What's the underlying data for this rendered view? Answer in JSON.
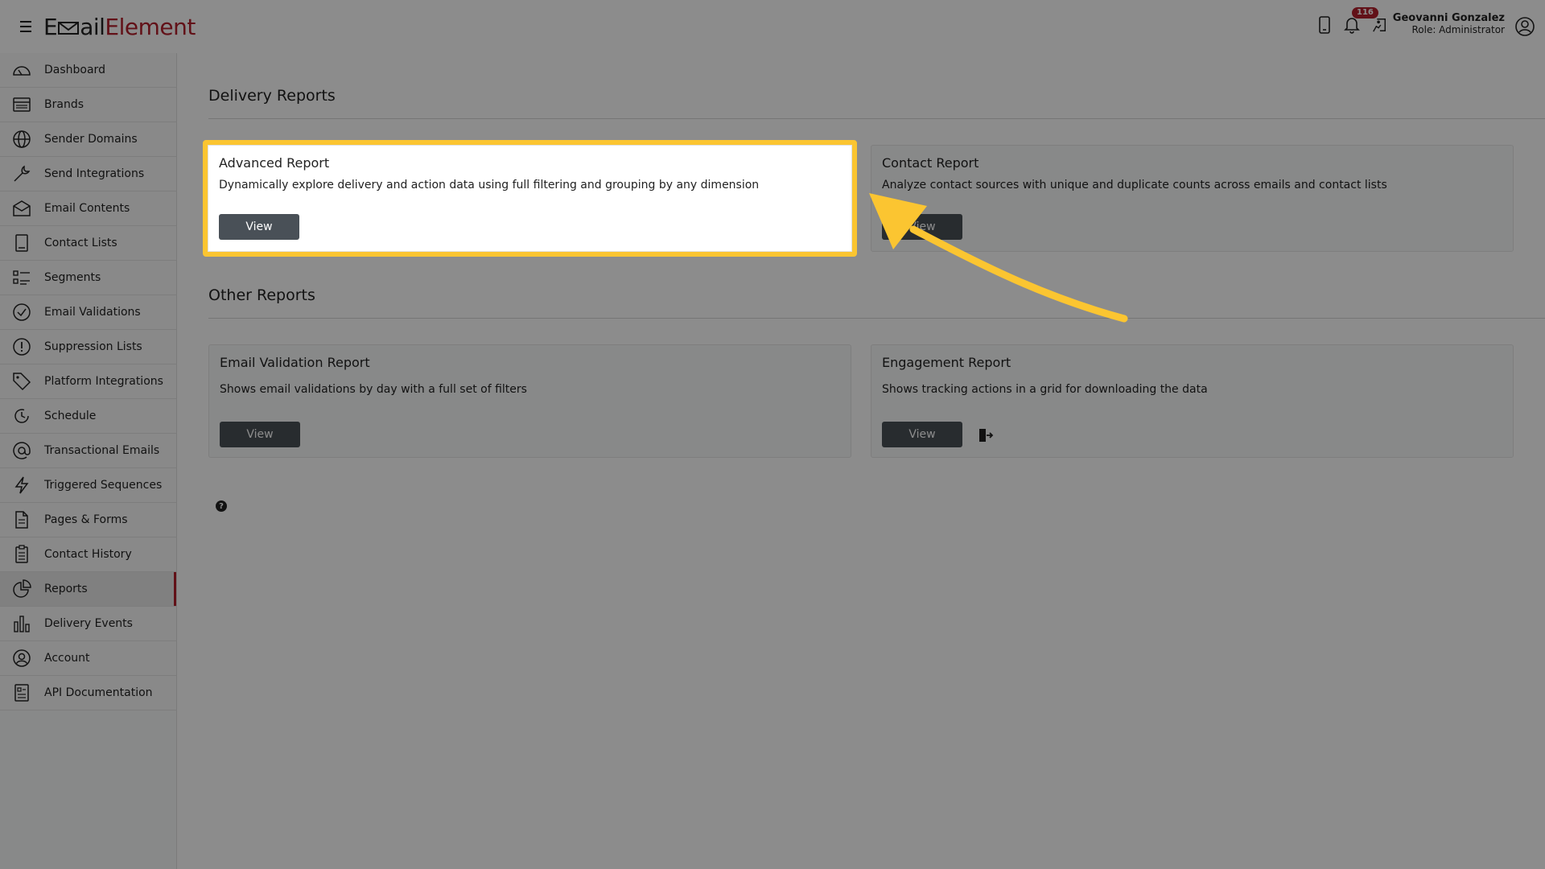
{
  "app": {
    "logo_part1": "E",
    "logo_part2": "ail",
    "logo_part3": "Element"
  },
  "header": {
    "notification_count": "116",
    "user_name": "Geovanni Gonzalez",
    "user_role": "Role: Administrator"
  },
  "sidebar": {
    "items": [
      {
        "label": "Dashboard",
        "icon": "dashboard-icon"
      },
      {
        "label": "Brands",
        "icon": "brands-icon"
      },
      {
        "label": "Sender Domains",
        "icon": "globe-icon"
      },
      {
        "label": "Send Integrations",
        "icon": "wrench-icon"
      },
      {
        "label": "Email Contents",
        "icon": "envelope-icon"
      },
      {
        "label": "Contact Lists",
        "icon": "contact-book-icon"
      },
      {
        "label": "Segments",
        "icon": "segments-icon"
      },
      {
        "label": "Email Validations",
        "icon": "check-circle-icon"
      },
      {
        "label": "Suppression Lists",
        "icon": "exclamation-circle-icon"
      },
      {
        "label": "Platform Integrations",
        "icon": "tag-icon"
      },
      {
        "label": "Schedule",
        "icon": "schedule-icon"
      },
      {
        "label": "Transactional Emails",
        "icon": "at-icon"
      },
      {
        "label": "Triggered Sequences",
        "icon": "lightning-icon"
      },
      {
        "label": "Pages & Forms",
        "icon": "document-icon"
      },
      {
        "label": "Contact History",
        "icon": "clipboard-icon"
      },
      {
        "label": "Reports",
        "icon": "pie-chart-icon",
        "active": true
      },
      {
        "label": "Delivery Events",
        "icon": "bar-chart-icon"
      },
      {
        "label": "Account",
        "icon": "user-circle-icon"
      },
      {
        "label": "API Documentation",
        "icon": "api-doc-icon"
      }
    ]
  },
  "main": {
    "delivery_title": "Delivery Reports",
    "other_title": "Other Reports",
    "cards": [
      {
        "title": "Advanced Report",
        "desc": "Dynamically explore delivery and action data using full filtering and grouping by any dimension",
        "button": "View"
      },
      {
        "title": "Contact Report",
        "desc": "Analyze contact sources with unique and duplicate counts across emails and contact lists",
        "button": "View"
      },
      {
        "title": "Email Validation Report",
        "desc": "Shows email validations by day with a full set of filters",
        "button": "View"
      },
      {
        "title": "Engagement Report",
        "desc": "Shows tracking actions in a grid for downloading the data",
        "button": "View"
      }
    ],
    "help_glyph": "?"
  },
  "colors": {
    "accent": "#b3202c",
    "highlight": "#fbc531",
    "button": "#495057"
  }
}
